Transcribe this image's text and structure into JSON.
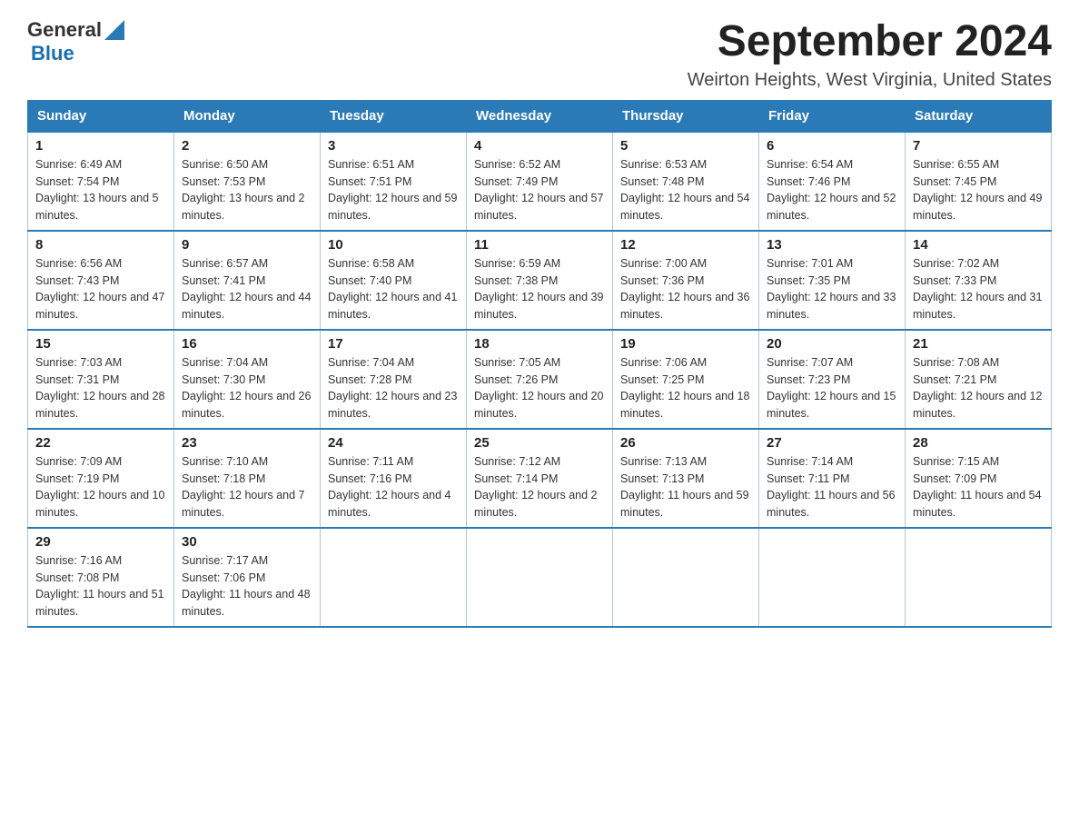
{
  "header": {
    "logo": {
      "general": "General",
      "blue": "Blue"
    },
    "title": "September 2024",
    "location": "Weirton Heights, West Virginia, United States"
  },
  "days_of_week": [
    "Sunday",
    "Monday",
    "Tuesday",
    "Wednesday",
    "Thursday",
    "Friday",
    "Saturday"
  ],
  "weeks": [
    [
      {
        "day": "1",
        "sunrise": "6:49 AM",
        "sunset": "7:54 PM",
        "daylight": "13 hours and 5 minutes."
      },
      {
        "day": "2",
        "sunrise": "6:50 AM",
        "sunset": "7:53 PM",
        "daylight": "13 hours and 2 minutes."
      },
      {
        "day": "3",
        "sunrise": "6:51 AM",
        "sunset": "7:51 PM",
        "daylight": "12 hours and 59 minutes."
      },
      {
        "day": "4",
        "sunrise": "6:52 AM",
        "sunset": "7:49 PM",
        "daylight": "12 hours and 57 minutes."
      },
      {
        "day": "5",
        "sunrise": "6:53 AM",
        "sunset": "7:48 PM",
        "daylight": "12 hours and 54 minutes."
      },
      {
        "day": "6",
        "sunrise": "6:54 AM",
        "sunset": "7:46 PM",
        "daylight": "12 hours and 52 minutes."
      },
      {
        "day": "7",
        "sunrise": "6:55 AM",
        "sunset": "7:45 PM",
        "daylight": "12 hours and 49 minutes."
      }
    ],
    [
      {
        "day": "8",
        "sunrise": "6:56 AM",
        "sunset": "7:43 PM",
        "daylight": "12 hours and 47 minutes."
      },
      {
        "day": "9",
        "sunrise": "6:57 AM",
        "sunset": "7:41 PM",
        "daylight": "12 hours and 44 minutes."
      },
      {
        "day": "10",
        "sunrise": "6:58 AM",
        "sunset": "7:40 PM",
        "daylight": "12 hours and 41 minutes."
      },
      {
        "day": "11",
        "sunrise": "6:59 AM",
        "sunset": "7:38 PM",
        "daylight": "12 hours and 39 minutes."
      },
      {
        "day": "12",
        "sunrise": "7:00 AM",
        "sunset": "7:36 PM",
        "daylight": "12 hours and 36 minutes."
      },
      {
        "day": "13",
        "sunrise": "7:01 AM",
        "sunset": "7:35 PM",
        "daylight": "12 hours and 33 minutes."
      },
      {
        "day": "14",
        "sunrise": "7:02 AM",
        "sunset": "7:33 PM",
        "daylight": "12 hours and 31 minutes."
      }
    ],
    [
      {
        "day": "15",
        "sunrise": "7:03 AM",
        "sunset": "7:31 PM",
        "daylight": "12 hours and 28 minutes."
      },
      {
        "day": "16",
        "sunrise": "7:04 AM",
        "sunset": "7:30 PM",
        "daylight": "12 hours and 26 minutes."
      },
      {
        "day": "17",
        "sunrise": "7:04 AM",
        "sunset": "7:28 PM",
        "daylight": "12 hours and 23 minutes."
      },
      {
        "day": "18",
        "sunrise": "7:05 AM",
        "sunset": "7:26 PM",
        "daylight": "12 hours and 20 minutes."
      },
      {
        "day": "19",
        "sunrise": "7:06 AM",
        "sunset": "7:25 PM",
        "daylight": "12 hours and 18 minutes."
      },
      {
        "day": "20",
        "sunrise": "7:07 AM",
        "sunset": "7:23 PM",
        "daylight": "12 hours and 15 minutes."
      },
      {
        "day": "21",
        "sunrise": "7:08 AM",
        "sunset": "7:21 PM",
        "daylight": "12 hours and 12 minutes."
      }
    ],
    [
      {
        "day": "22",
        "sunrise": "7:09 AM",
        "sunset": "7:19 PM",
        "daylight": "12 hours and 10 minutes."
      },
      {
        "day": "23",
        "sunrise": "7:10 AM",
        "sunset": "7:18 PM",
        "daylight": "12 hours and 7 minutes."
      },
      {
        "day": "24",
        "sunrise": "7:11 AM",
        "sunset": "7:16 PM",
        "daylight": "12 hours and 4 minutes."
      },
      {
        "day": "25",
        "sunrise": "7:12 AM",
        "sunset": "7:14 PM",
        "daylight": "12 hours and 2 minutes."
      },
      {
        "day": "26",
        "sunrise": "7:13 AM",
        "sunset": "7:13 PM",
        "daylight": "11 hours and 59 minutes."
      },
      {
        "day": "27",
        "sunrise": "7:14 AM",
        "sunset": "7:11 PM",
        "daylight": "11 hours and 56 minutes."
      },
      {
        "day": "28",
        "sunrise": "7:15 AM",
        "sunset": "7:09 PM",
        "daylight": "11 hours and 54 minutes."
      }
    ],
    [
      {
        "day": "29",
        "sunrise": "7:16 AM",
        "sunset": "7:08 PM",
        "daylight": "11 hours and 51 minutes."
      },
      {
        "day": "30",
        "sunrise": "7:17 AM",
        "sunset": "7:06 PM",
        "daylight": "11 hours and 48 minutes."
      },
      null,
      null,
      null,
      null,
      null
    ]
  ],
  "labels": {
    "sunrise": "Sunrise:",
    "sunset": "Sunset:",
    "daylight": "Daylight:"
  }
}
